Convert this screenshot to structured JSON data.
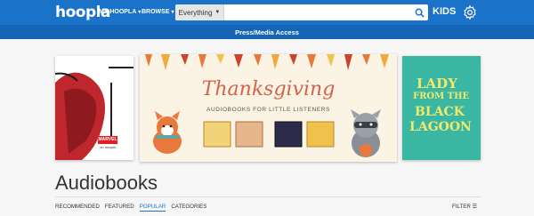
{
  "header": {
    "logo": "hoopla",
    "nav_my_hoopla": "MY HOOPLA",
    "nav_browse": "BROWSE",
    "search_scope": "Everything",
    "search_placeholder": "",
    "kids_label": "KIDS"
  },
  "banner": {
    "text": "Press/Media Access"
  },
  "carousel": {
    "left_card": {
      "label": "MARVEL",
      "sublabel": "on hoopla"
    },
    "main_card": {
      "title": "Thanksgiving",
      "subtitle": "AUDIOBOOKS FOR LITTLE LISTENERS"
    },
    "right_card": {
      "line1": "LADY",
      "line2": "FROM THE",
      "line3": "BLACK",
      "line4": "LAGOON"
    }
  },
  "page": {
    "title": "Audiobooks",
    "tabs": [
      {
        "label": "RECOMMENDED",
        "active": false
      },
      {
        "label": "FEATURED",
        "active": false
      },
      {
        "label": "POPULAR",
        "active": true
      },
      {
        "label": "CATEGORIES",
        "active": false
      }
    ],
    "filter_label": "FILTER"
  },
  "colors": {
    "header_bg": "#1a73c8",
    "subbar_bg": "#1565b7",
    "accent": "#1a73c8"
  }
}
